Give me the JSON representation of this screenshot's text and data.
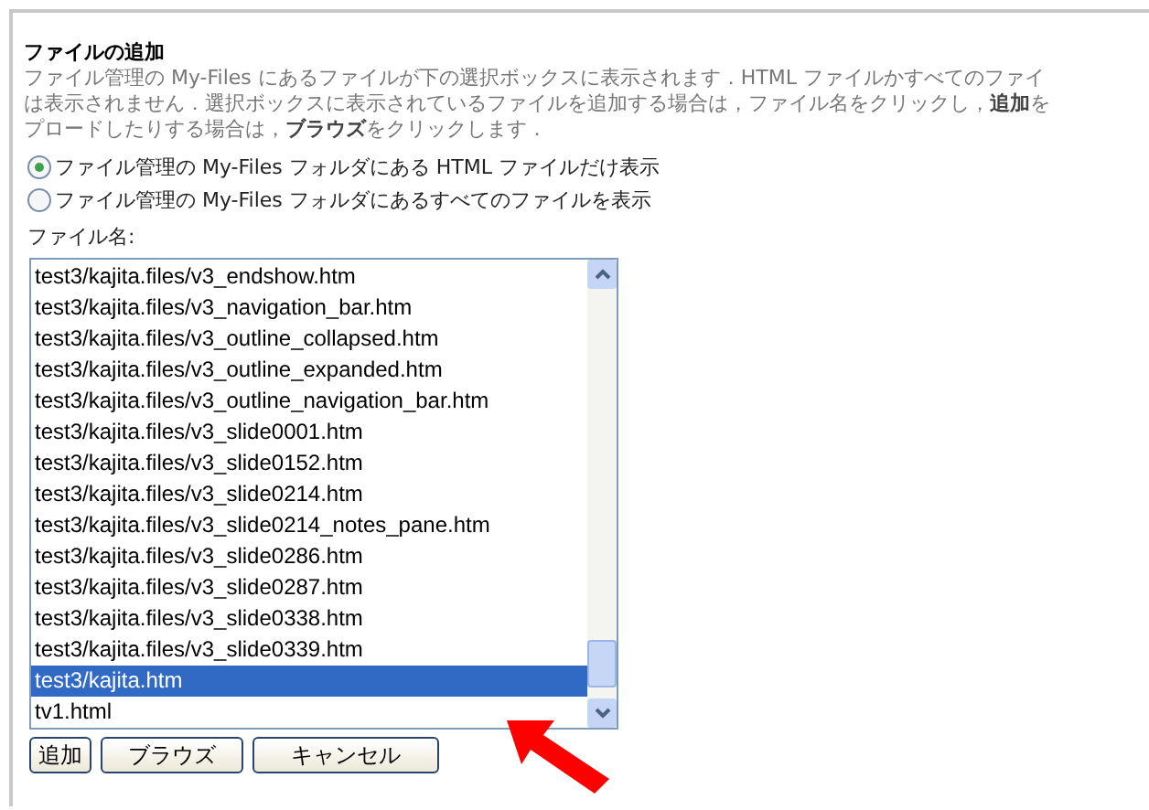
{
  "panel": {
    "title": "ファイルの追加",
    "description": [
      "ファイル管理の My-Files にあるファイルが下の選択ボックスに表示されます．HTML ファイルかすべてのファイ",
      "は表示されません．選択ボックスに表示されているファイルを追加する場合は，ファイル名をクリックし，**追加**を",
      "プロードしたりする場合は，**ブラウズ**をクリックします．"
    ],
    "options": [
      {
        "label": "ファイル管理の My-Files フォルダにある HTML ファイルだけ表示",
        "selected": true
      },
      {
        "label": "ファイル管理の My-Files フォルダにあるすべてのファイルを表示",
        "selected": false
      }
    ],
    "file_label": "ファイル名:",
    "files": [
      {
        "name": "test3/kajita.files/v3_endshow.htm",
        "selected": false
      },
      {
        "name": "test3/kajita.files/v3_navigation_bar.htm",
        "selected": false
      },
      {
        "name": "test3/kajita.files/v3_outline_collapsed.htm",
        "selected": false
      },
      {
        "name": "test3/kajita.files/v3_outline_expanded.htm",
        "selected": false
      },
      {
        "name": "test3/kajita.files/v3_outline_navigation_bar.htm",
        "selected": false
      },
      {
        "name": "test3/kajita.files/v3_slide0001.htm",
        "selected": false
      },
      {
        "name": "test3/kajita.files/v3_slide0152.htm",
        "selected": false
      },
      {
        "name": "test3/kajita.files/v3_slide0214.htm",
        "selected": false
      },
      {
        "name": "test3/kajita.files/v3_slide0214_notes_pane.htm",
        "selected": false
      },
      {
        "name": "test3/kajita.files/v3_slide0286.htm",
        "selected": false
      },
      {
        "name": "test3/kajita.files/v3_slide0287.htm",
        "selected": false
      },
      {
        "name": "test3/kajita.files/v3_slide0338.htm",
        "selected": false
      },
      {
        "name": "test3/kajita.files/v3_slide0339.htm",
        "selected": false
      },
      {
        "name": "test3/kajita.htm",
        "selected": true
      },
      {
        "name": "tv1.html",
        "selected": false
      }
    ],
    "buttons": [
      "追加",
      "ブラウズ",
      "キャンセル"
    ]
  }
}
